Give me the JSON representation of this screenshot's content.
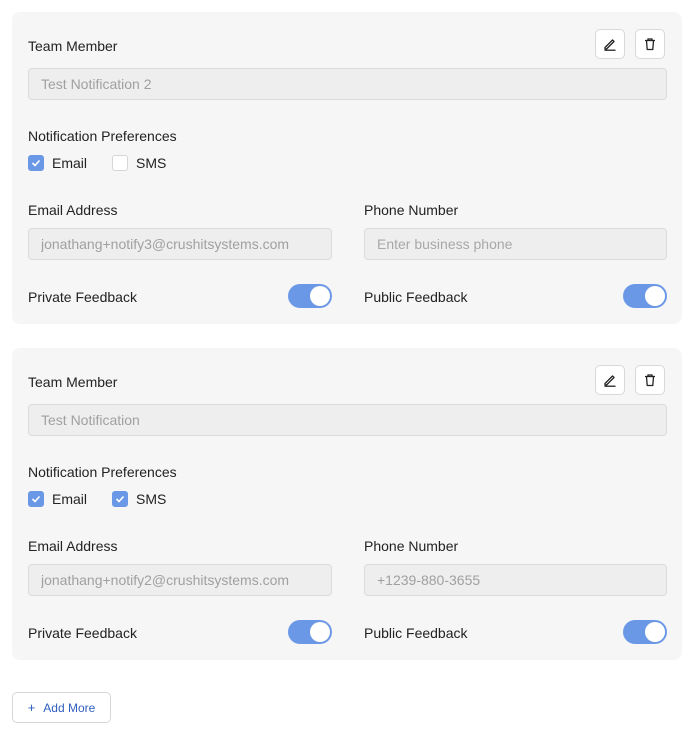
{
  "cards": [
    {
      "team_member_label": "Team Member",
      "team_member_value": "Test Notification 2",
      "notification_prefs_label": "Notification Preferences",
      "email_label": "Email",
      "email_checked": true,
      "sms_label": "SMS",
      "sms_checked": false,
      "email_address_label": "Email Address",
      "email_address_value": "jonathang+notify3@crushitsystems.com",
      "phone_label": "Phone Number",
      "phone_placeholder": "Enter business phone",
      "phone_value": "",
      "private_feedback_label": "Private Feedback",
      "private_feedback_on": true,
      "public_feedback_label": "Public Feedback",
      "public_feedback_on": true
    },
    {
      "team_member_label": "Team Member",
      "team_member_value": "Test Notification",
      "notification_prefs_label": "Notification Preferences",
      "email_label": "Email",
      "email_checked": true,
      "sms_label": "SMS",
      "sms_checked": true,
      "email_address_label": "Email Address",
      "email_address_value": "jonathang+notify2@crushitsystems.com",
      "phone_label": "Phone Number",
      "phone_placeholder": "",
      "phone_value": "+1239-880-3655",
      "private_feedback_label": "Private Feedback",
      "private_feedback_on": true,
      "public_feedback_label": "Public Feedback",
      "public_feedback_on": true
    }
  ],
  "add_more": {
    "label": "Add More",
    "icon": "plus-icon"
  },
  "icons": {
    "edit": "pencil-icon",
    "delete": "trash-icon"
  },
  "colors": {
    "accent": "#6b98e6",
    "link": "#2f5fbf",
    "card_bg": "#f6f6f6"
  }
}
